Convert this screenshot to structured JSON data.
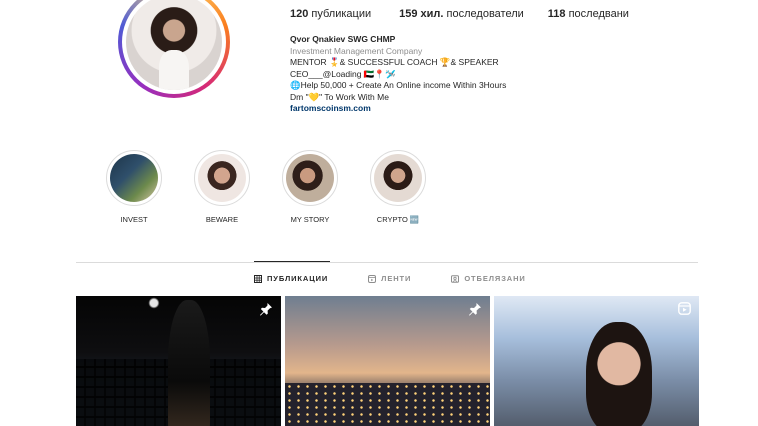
{
  "profile": {
    "stats": {
      "posts_count": "120",
      "posts_label": "публикации",
      "followers_count": "159 хил.",
      "followers_label": "последователи",
      "following_count": "118",
      "following_label": "последвани"
    },
    "bio": {
      "name": "Qvor Qnakiev SWG CHMP",
      "category": "Investment Management Company",
      "line1": "MENTOR 🎖️& SUCCESSFUL COACH 🏆& SPEAKER",
      "line2": "CEO___@Loading 🇦🇪📍🛩️",
      "line3": "🌐Help 50,000 + Create An Online income Within 3Hours",
      "line4": "Dm \"💛\" To Work With Me",
      "link": "fartomscoinsm.com"
    }
  },
  "highlights": [
    {
      "label": "INVEST"
    },
    {
      "label": "BEWARE"
    },
    {
      "label": "MY STORY"
    },
    {
      "label": "CRYPTO 🆕"
    }
  ],
  "tabs": [
    {
      "label": "ПУБЛИКАЦИИ",
      "icon": "grid-icon",
      "active": true
    },
    {
      "label": "ЛЕНТИ",
      "icon": "reels-icon",
      "active": false
    },
    {
      "label": "ОТБЕЛЯЗАНИ",
      "icon": "tagged-icon",
      "active": false
    }
  ],
  "posts": [
    {
      "badge": "pin-icon"
    },
    {
      "badge": "pin-icon"
    },
    {
      "badge": "reel-icon"
    }
  ]
}
